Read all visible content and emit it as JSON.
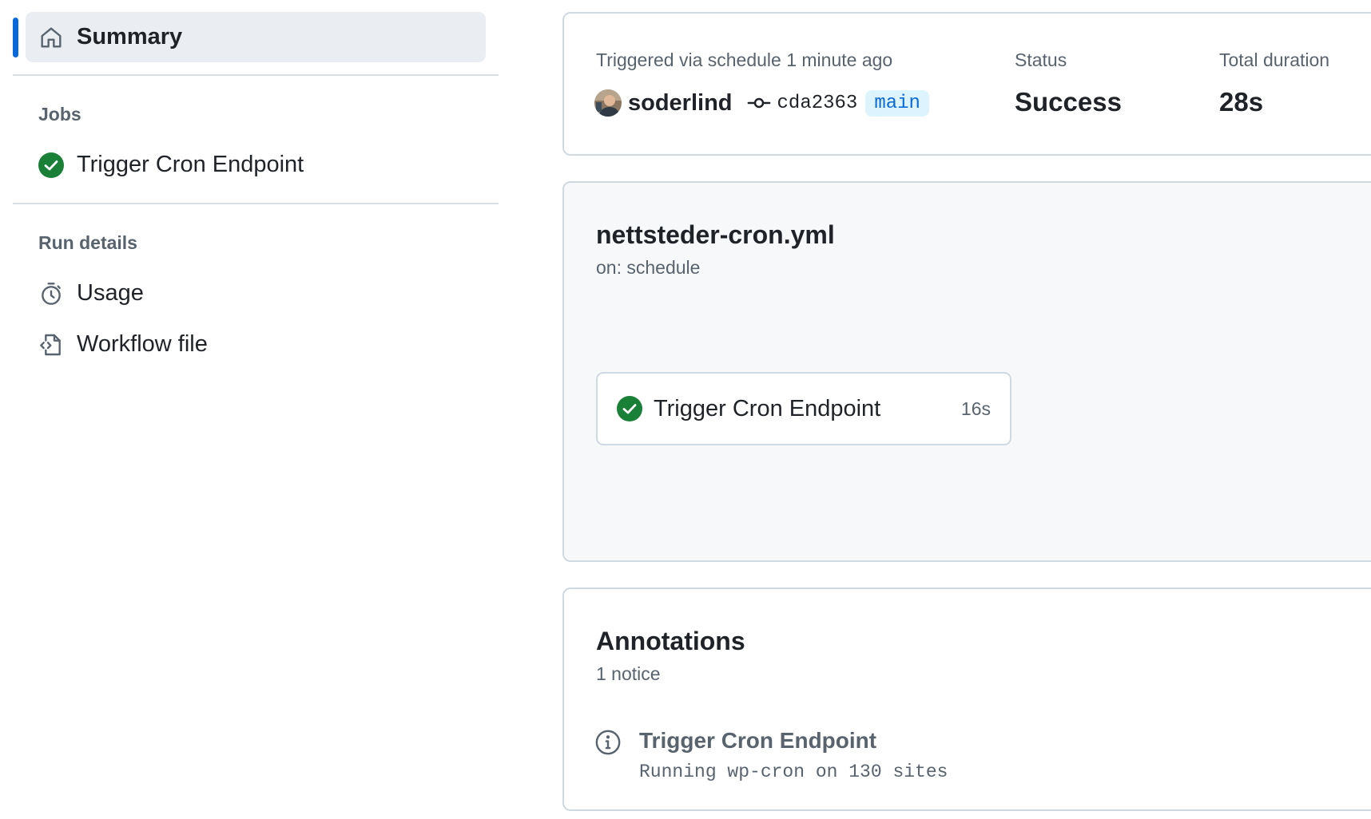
{
  "sidebar": {
    "summary_label": "Summary",
    "jobs_heading": "Jobs",
    "jobs": [
      {
        "label": "Trigger Cron Endpoint",
        "status": "success"
      }
    ],
    "run_details_heading": "Run details",
    "run_details": [
      {
        "label": "Usage",
        "icon": "stopwatch-icon"
      },
      {
        "label": "Workflow file",
        "icon": "file-code-icon"
      }
    ]
  },
  "run": {
    "trigger_text": "Triggered via schedule 1 minute ago",
    "actor": "soderlind",
    "commit_sha": "cda2363",
    "branch": "main",
    "status_label": "Status",
    "status_value": "Success",
    "duration_label": "Total duration",
    "duration_value": "28s"
  },
  "workflow": {
    "file": "nettsteder-cron.yml",
    "trigger": "on: schedule",
    "job": {
      "name": "Trigger Cron Endpoint",
      "duration": "16s"
    }
  },
  "annotations": {
    "title": "Annotations",
    "count": "1 notice",
    "items": [
      {
        "job": "Trigger Cron Endpoint",
        "message": "Running wp-cron on 130 sites"
      }
    ]
  },
  "colors": {
    "accent": "#0969da",
    "success": "#1a7f37",
    "muted": "#59636e",
    "border": "#d1d9e0"
  }
}
